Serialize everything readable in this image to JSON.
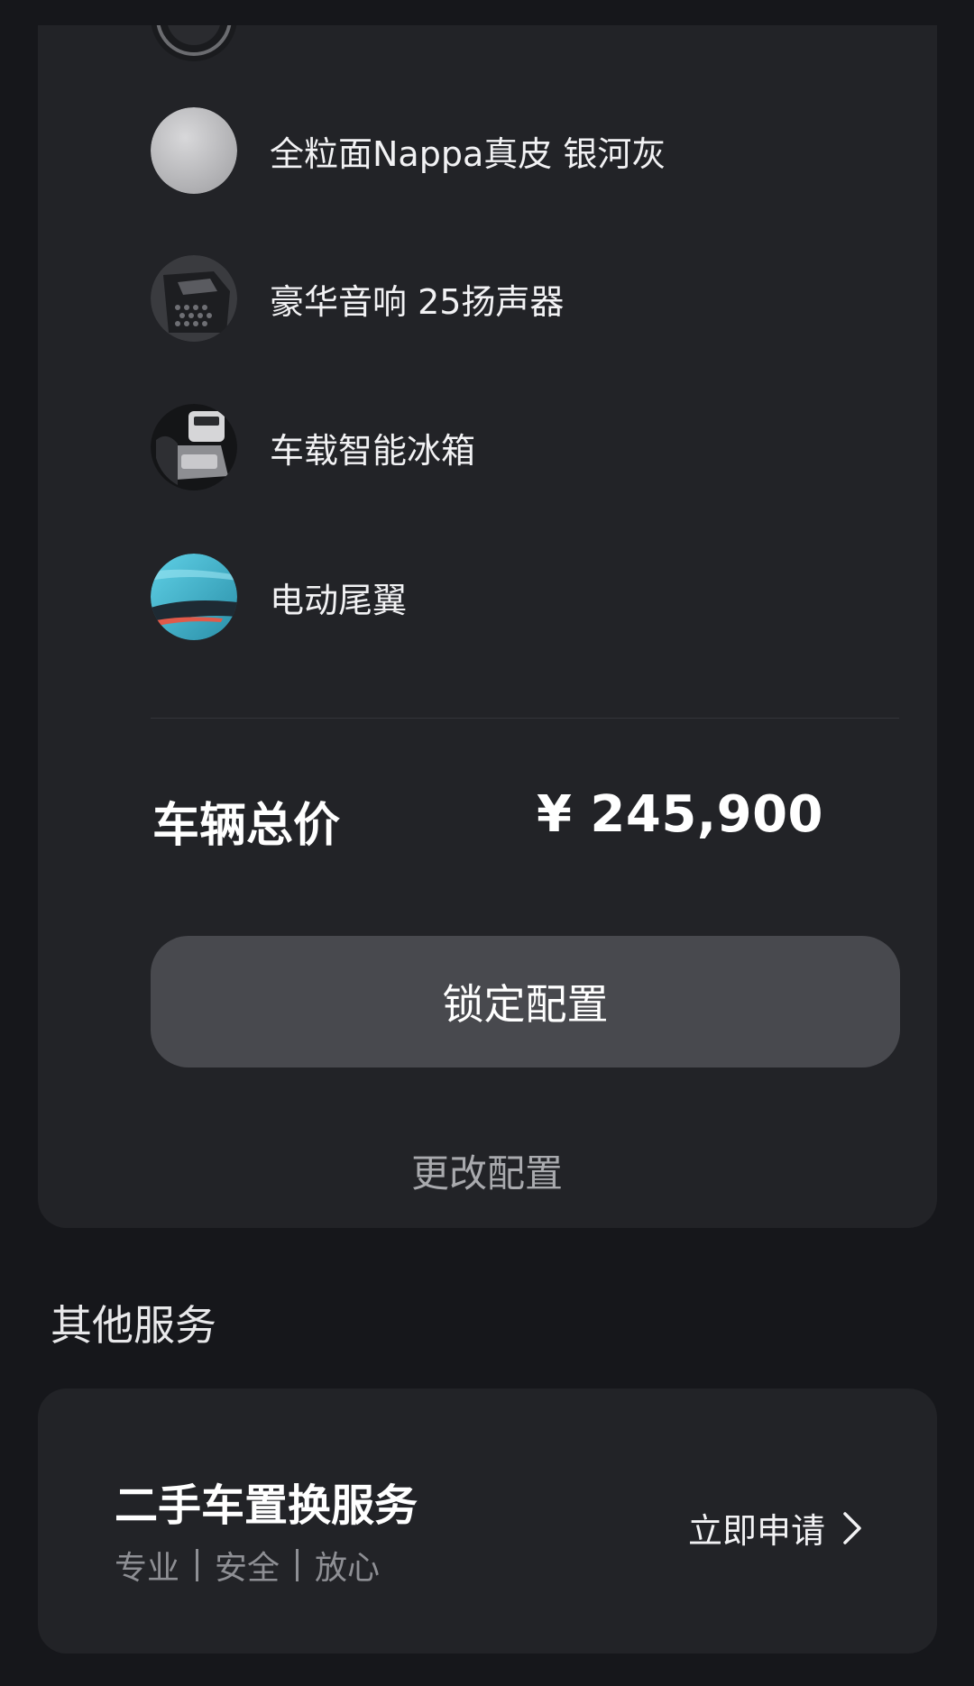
{
  "options": [
    {
      "label": "全粒面Nappa真皮 银河灰",
      "icon": "leather-swatch-icon"
    },
    {
      "label": "豪华音响 25扬声器",
      "icon": "speaker-icon"
    },
    {
      "label": "车载智能冰箱",
      "icon": "fridge-icon"
    },
    {
      "label": "电动尾翼",
      "icon": "spoiler-icon"
    }
  ],
  "total": {
    "label": "车辆总价",
    "price": "¥ 245,900"
  },
  "actions": {
    "lock_label": "锁定配置",
    "change_label": "更改配置"
  },
  "other_services": {
    "title": "其他服务",
    "card": {
      "title": "二手车置换服务",
      "tags": [
        "专业",
        "安全",
        "放心"
      ],
      "apply_label": "立即申请"
    }
  },
  "colors": {
    "background": "#16171b",
    "card": "#222327",
    "button": "#48494e",
    "muted_text": "#a9aaae",
    "accent_cyan": "#3fb6cf"
  }
}
